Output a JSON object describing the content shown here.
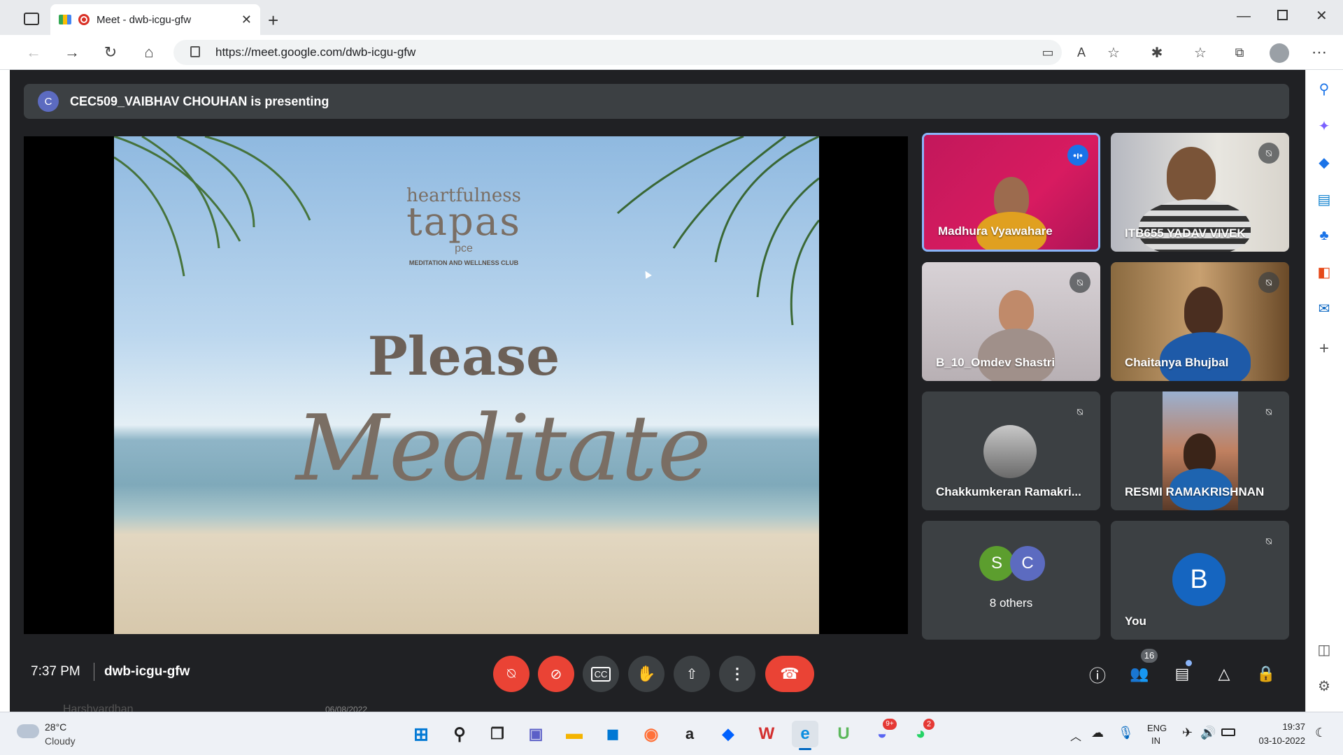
{
  "browser": {
    "tab_title": "Meet - dwb-icgu-gfw",
    "new_tab": "+",
    "url": "https://meet.google.com/dwb-icgu-gfw",
    "window_controls": [
      "minimize-icon",
      "maximize-icon",
      "close-icon"
    ]
  },
  "meet": {
    "presenter_initial": "C",
    "presenting_text": "CEC509_VAIBHAV CHOUHAN is presenting",
    "slide": {
      "brand_small": "heartfulness",
      "brand_main": "tapas",
      "brand_sub": "pce",
      "club": "MEDITATION AND WELLNESS CLUB",
      "line1": "Please",
      "line2": "Meditate"
    },
    "participants": [
      {
        "name": "Madhura Vyawahare",
        "state": "speaking"
      },
      {
        "name": "ITB655 YADAV VIVEK",
        "state": "muted"
      },
      {
        "name": "B_10_Omdev Shastri",
        "state": "muted"
      },
      {
        "name": "Chaitanya Bhujbal",
        "state": "muted"
      },
      {
        "name": "Chakkumkeran Ramakri...",
        "state": "muted"
      },
      {
        "name": "RESMI RAMAKRISHNAN",
        "state": "muted"
      }
    ],
    "others": {
      "initials": [
        "S",
        "C"
      ],
      "label": "8 others"
    },
    "self": {
      "initial": "B",
      "label": "You"
    },
    "time": "7:37 PM",
    "meeting_code": "dwb-icgu-gfw",
    "people_count": "16",
    "colors": {
      "end_call": "#ea4335",
      "background": "#202124",
      "tile": "#3c4043",
      "speaking_border": "#8ab4f8"
    }
  },
  "taskbar": {
    "weather_temp": "28°C",
    "weather_desc": "Cloudy",
    "background_text": "Harshvardhan",
    "background_date": "06/08/2022",
    "lang_line1": "ENG",
    "lang_line2": "IN",
    "clock_time": "19:37",
    "clock_date": "03-10-2022",
    "discord_badge": "9+",
    "whatsapp_badge": "2"
  }
}
